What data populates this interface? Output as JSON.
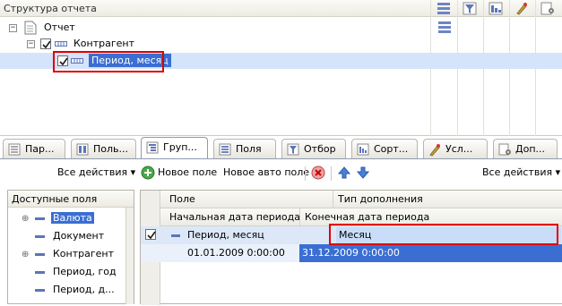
{
  "structure": {
    "title": "Структура отчета",
    "tree": [
      {
        "label": "Отчет"
      },
      {
        "label": "Контрагент"
      },
      {
        "label": "Период, месяц"
      }
    ]
  },
  "tabs": [
    {
      "label": "Пар..."
    },
    {
      "label": "Поль..."
    },
    {
      "label": "Груп..."
    },
    {
      "label": "Поля"
    },
    {
      "label": "Отбор"
    },
    {
      "label": "Сорт..."
    },
    {
      "label": "Усл..."
    },
    {
      "label": "Доп..."
    }
  ],
  "toolbar": {
    "all_actions_left": "Все действия ▾",
    "new_field": "Новое поле",
    "new_auto_field": "Новое авто поле",
    "all_actions_right": "Все действия ▾"
  },
  "available_fields": {
    "header": "Доступные поля",
    "items": [
      {
        "label": "Валюта"
      },
      {
        "label": "Документ"
      },
      {
        "label": "Контрагент"
      },
      {
        "label": "Период, год"
      },
      {
        "label": "Период, д..."
      }
    ]
  },
  "grid": {
    "col_field": "Поле",
    "col_addition_type": "Тип дополнения",
    "col_start_date": "Начальная дата периода",
    "col_end_date": "Конечная дата периода",
    "row": {
      "field": "Период, месяц",
      "addition_type": "Месяц",
      "start_date": "01.01.2009 0:00:00",
      "end_date": "31.12.2009 0:00:00"
    }
  },
  "colors": {
    "selection": "#d4e4fa",
    "highlight_frame": "#e00000",
    "accent": "#3a6ed3"
  }
}
